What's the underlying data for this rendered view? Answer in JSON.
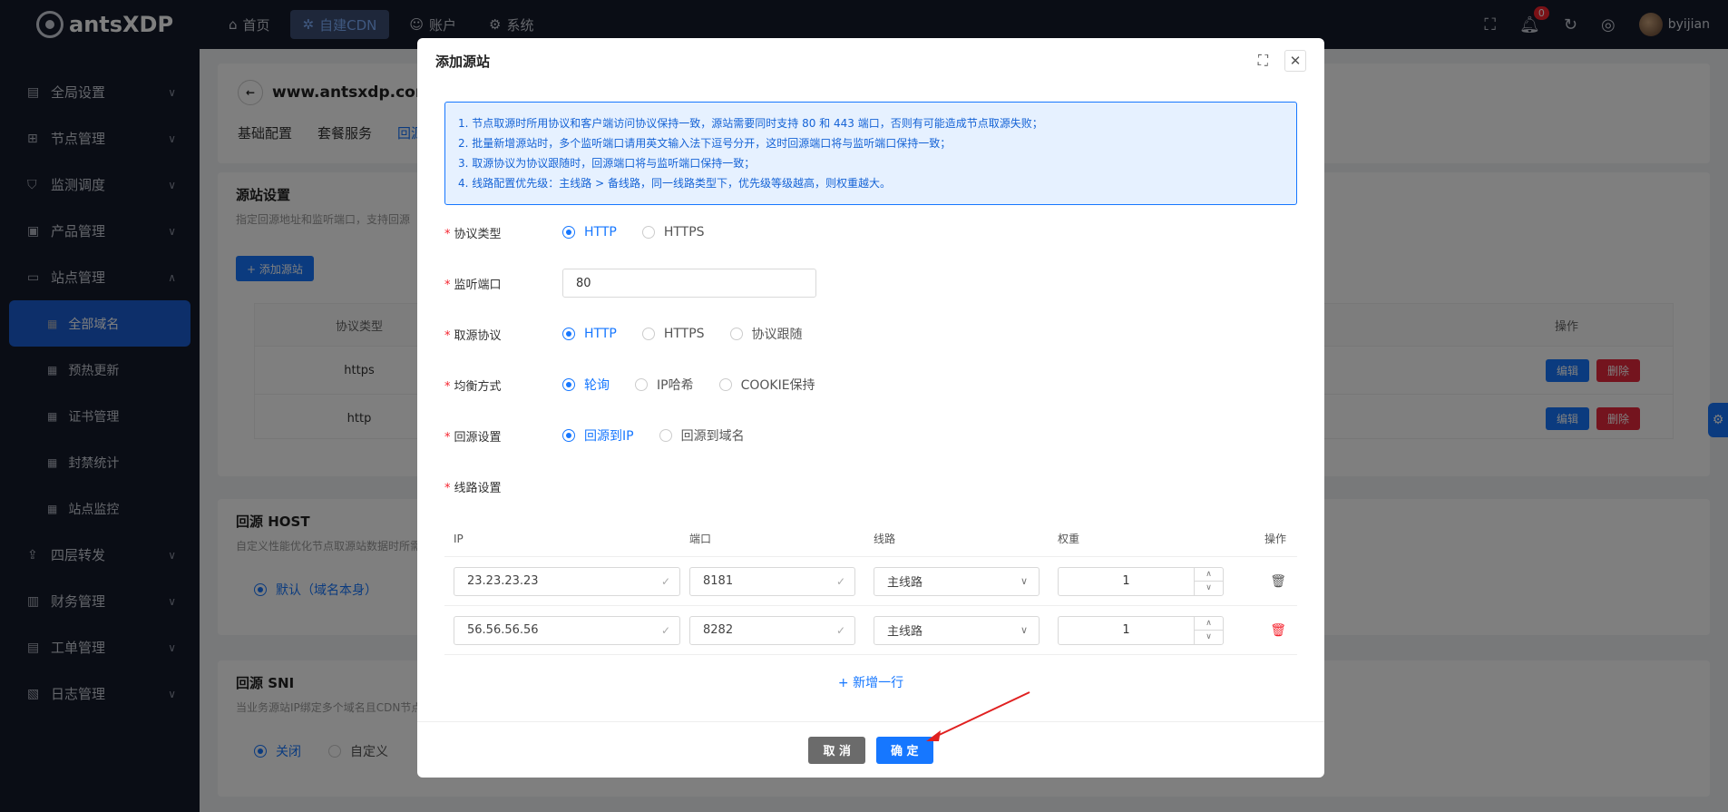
{
  "topbar": {
    "logo": "antsXDP",
    "nav": [
      {
        "label": "首页",
        "icon": "home-icon"
      },
      {
        "label": "自建CDN",
        "icon": "cdn-icon"
      },
      {
        "label": "账户",
        "icon": "user-icon"
      },
      {
        "label": "系统",
        "icon": "gear-icon"
      }
    ],
    "notification_count": "0",
    "username": "byijian"
  },
  "sidebar": {
    "items": [
      {
        "label": "全局设置"
      },
      {
        "label": "节点管理"
      },
      {
        "label": "监测调度"
      },
      {
        "label": "产品管理"
      },
      {
        "label": "站点管理"
      }
    ],
    "site_sub": [
      {
        "label": "全部域名"
      },
      {
        "label": "预热更新"
      },
      {
        "label": "证书管理"
      },
      {
        "label": "封禁统计"
      },
      {
        "label": "站点监控"
      }
    ],
    "items_after": [
      {
        "label": "四层转发"
      },
      {
        "label": "财务管理"
      },
      {
        "label": "工单管理"
      },
      {
        "label": "日志管理"
      }
    ]
  },
  "background": {
    "domain": "www.antsxdp.com",
    "tabs": [
      "基础配置",
      "套餐服务",
      "回源"
    ],
    "origin_section_title": "源站设置",
    "origin_section_desc": "指定回源地址和监听端口，支持回源",
    "add_origin_btn": "+ 添加源站",
    "table_header_protocol": "协议类型",
    "table_header_ops": "操作",
    "rows": [
      {
        "protocol": "https",
        "edit": "编辑",
        "delete": "删除"
      },
      {
        "protocol": "http",
        "edit": "编辑",
        "delete": "删除"
      }
    ],
    "host_section_title": "回源 HOST",
    "host_section_desc": "自定义性能优化节点取源站数据时所需",
    "host_default": "默认（域名本身）",
    "sni_section_title": "回源 SNI",
    "sni_section_desc": "当业务源站IP绑定多个域名且CDN节点",
    "sni_off": "关闭",
    "sni_custom": "自定义"
  },
  "modal": {
    "title": "添加源站",
    "notice": [
      "1. 节点取源时所用协议和客户端访问协议保持一致，源站需要同时支持 80 和 443 端口，否则有可能造成节点取源失败；",
      "2. 批量新增源站时，多个监听端口请用英文输入法下逗号分开，这时回源端口将与监听端口保持一致；",
      "3. 取源协议为协议跟随时，回源端口将与监听端口保持一致；",
      "4. 线路配置优先级：主线路 > 备线路，同一线路类型下，优先级等级越高，则权重越大。"
    ],
    "protocol_type": {
      "label": "协议类型",
      "options": [
        "HTTP",
        "HTTPS"
      ],
      "selected": "HTTP"
    },
    "listen_port": {
      "label": "监听端口",
      "value": "80"
    },
    "origin_protocol": {
      "label": "取源协议",
      "options": [
        "HTTP",
        "HTTPS",
        "协议跟随"
      ],
      "selected": "HTTP"
    },
    "balance": {
      "label": "均衡方式",
      "options": [
        "轮询",
        "IP哈希",
        "COOKIE保持"
      ],
      "selected": "轮询"
    },
    "back_to_origin": {
      "label": "回源设置",
      "options": [
        "回源到IP",
        "回源到域名"
      ],
      "selected": "回源到IP"
    },
    "lines": {
      "label": "线路设置",
      "headers": [
        "IP",
        "端口",
        "线路",
        "权重",
        "操作"
      ],
      "rows": [
        {
          "ip": "23.23.23.23",
          "port": "8181",
          "line": "主线路",
          "weight": "1"
        },
        {
          "ip": "56.56.56.56",
          "port": "8282",
          "line": "主线路",
          "weight": "1"
        }
      ],
      "add_row": "+ 新增一行"
    },
    "cancel": "取 消",
    "confirm": "确 定"
  }
}
